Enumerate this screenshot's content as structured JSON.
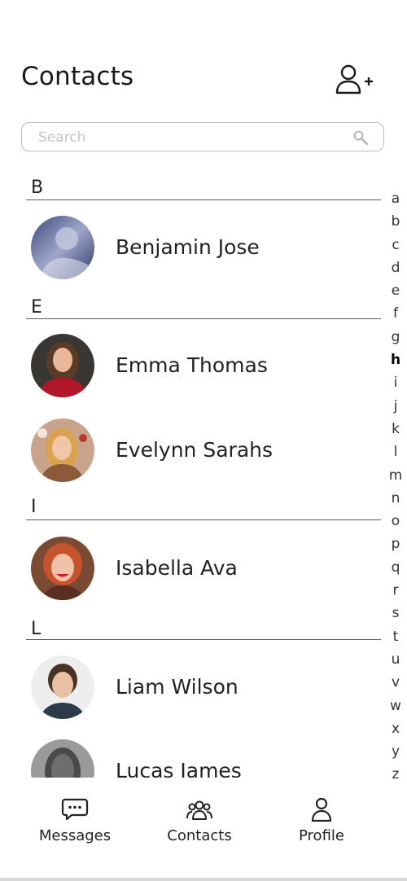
{
  "header": {
    "title": "Contacts"
  },
  "search": {
    "placeholder": "Search"
  },
  "sections": [
    {
      "letter": "B",
      "contacts": [
        {
          "name": "Benjamin Jose"
        }
      ]
    },
    {
      "letter": "E",
      "contacts": [
        {
          "name": "Emma Thomas"
        },
        {
          "name": "Evelynn Sarahs"
        }
      ]
    },
    {
      "letter": "I",
      "contacts": [
        {
          "name": "Isabella Ava"
        }
      ]
    },
    {
      "letter": "L",
      "contacts": [
        {
          "name": "Liam Wilson"
        },
        {
          "name": "Lucas James"
        }
      ]
    }
  ],
  "alphabet": [
    "a",
    "b",
    "c",
    "d",
    "e",
    "f",
    "g",
    "h",
    "i",
    "j",
    "k",
    "l",
    "m",
    "n",
    "o",
    "p",
    "q",
    "r",
    "s",
    "t",
    "u",
    "v",
    "w",
    "x",
    "y",
    "z"
  ],
  "alphabet_active": "h",
  "nav": [
    {
      "label": "Messages",
      "icon": "chat-icon"
    },
    {
      "label": "Contacts",
      "icon": "group-icon"
    },
    {
      "label": "Profile",
      "icon": "user-icon"
    }
  ],
  "colors": {
    "accent": "#b9bccf",
    "text": "#222222",
    "divider": "#5a5a5a"
  }
}
